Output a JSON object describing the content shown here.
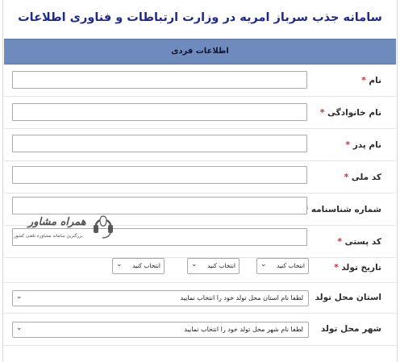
{
  "header": {
    "title": "سامانه جذب سرباز امریه در وزارت ارتباطات و فناوری اطلاعات",
    "section": "اطلاعات فردی"
  },
  "form": {
    "required_mark": "*",
    "first_name_label": "نام",
    "last_name_label": "نام خانوادگی",
    "father_name_label": "نام پدر",
    "national_code_label": "کد ملی",
    "id_number_label": "شماره شناسنامه",
    "postal_code_label": "کد پستی",
    "birth_date_label": "تاریخ تولد",
    "birth_year_value": "انتخاب کنید",
    "birth_month_value": "انتخاب کنید",
    "birth_day_value": "انتخاب کنید",
    "birth_province_label": "استان محل تولد",
    "birth_province_value": "لطفا نام استان محل تولد خود را انتخاب نمایید",
    "birth_city_label": "شهر محل تولد",
    "birth_city_value": "لطفا نام شهر محل تولد خود را انتخاب نمایید"
  },
  "watermark": {
    "title": "همراه مشاور",
    "subtitle": "بزرگترین سامانه مشاوره تلفنی کشور"
  },
  "colors": {
    "title": "#1f2a8a",
    "section_header_bg": "#6f8bbd",
    "required": "#d52b2b"
  },
  "icons": {
    "dropdown": "chevron-down-icon",
    "logo": "headset-icon"
  }
}
